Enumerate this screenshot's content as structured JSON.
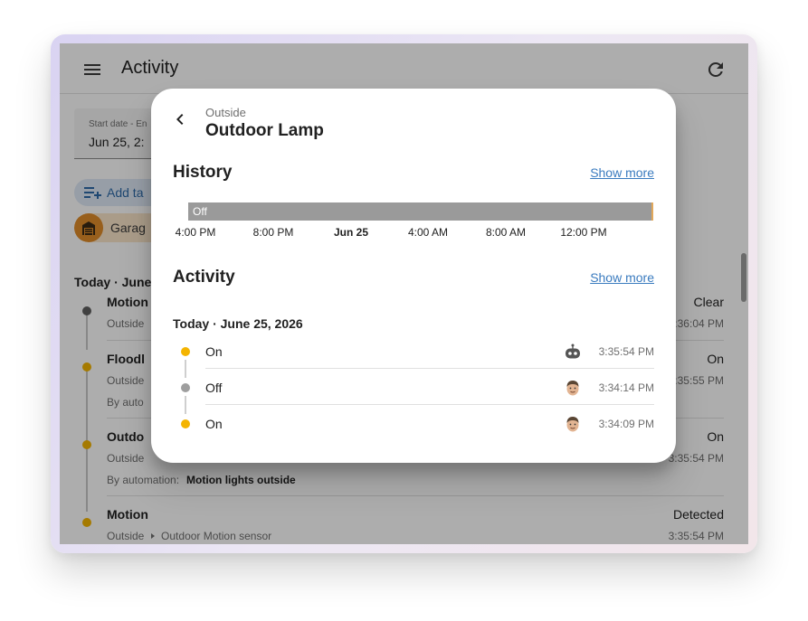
{
  "app": {
    "title": "Activity",
    "date_field": {
      "label": "Start date - En",
      "value": "Jun 25, 2:"
    },
    "add_target_label": "Add ta",
    "garage_chip_label": "Garag",
    "day_title": "Today · June",
    "entries": [
      {
        "name": "Motion",
        "sub": "Outside",
        "state": "Clear",
        "time": "3:36:04 PM",
        "dot_color": "#5f5f5f"
      },
      {
        "name": "Floodl",
        "sub": "Outside",
        "by_label": "By auto",
        "state": "On",
        "time": "3:35:55 PM",
        "dot_color": "#f4b400"
      },
      {
        "name": "Outdo",
        "sub": "Outside",
        "by_label": "By automation:",
        "by_value": "Motion lights outside",
        "state": "On",
        "time": "3:35:54 PM",
        "dot_color": "#f4b400"
      },
      {
        "name": "Motion",
        "sub_area": "Outside",
        "sub_device": "Outdoor Motion sensor",
        "state": "Detected",
        "time": "3:35:54 PM",
        "dot_color": "#f4b400"
      }
    ]
  },
  "dialog": {
    "area": "Outside",
    "title": "Outdoor Lamp",
    "history": {
      "title": "History",
      "show_more": "Show more",
      "bar_state": "Off",
      "ticks": [
        "4:00 PM",
        "8:00 PM",
        "Jun 25",
        "4:00 AM",
        "8:00 AM",
        "12:00 PM"
      ]
    },
    "activity": {
      "title": "Activity",
      "show_more": "Show more",
      "day_title": "Today · June 25, 2026",
      "rows": [
        {
          "state": "On",
          "time": "3:35:54 PM",
          "avatar": "robot-icon",
          "dot_color": "#f4b400"
        },
        {
          "state": "Off",
          "time": "3:34:14 PM",
          "avatar": "user-avatar",
          "dot_color": "#9e9e9e"
        },
        {
          "state": "On",
          "time": "3:34:09 PM",
          "avatar": "user-avatar",
          "dot_color": "#f4b400"
        }
      ]
    }
  }
}
